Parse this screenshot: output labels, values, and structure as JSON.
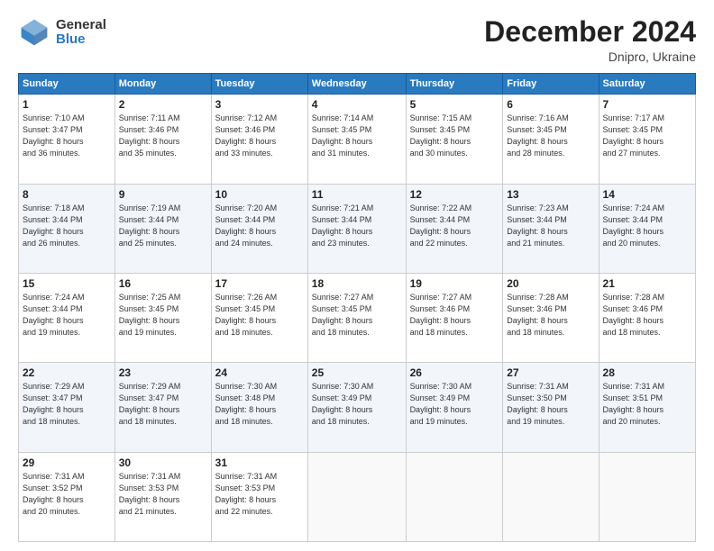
{
  "logo": {
    "general": "General",
    "blue": "Blue"
  },
  "title": {
    "month": "December 2024",
    "location": "Dnipro, Ukraine"
  },
  "weekdays": [
    "Sunday",
    "Monday",
    "Tuesday",
    "Wednesday",
    "Thursday",
    "Friday",
    "Saturday"
  ],
  "weeks": [
    [
      {
        "day": "1",
        "detail": "Sunrise: 7:10 AM\nSunset: 3:47 PM\nDaylight: 8 hours\nand 36 minutes."
      },
      {
        "day": "2",
        "detail": "Sunrise: 7:11 AM\nSunset: 3:46 PM\nDaylight: 8 hours\nand 35 minutes."
      },
      {
        "day": "3",
        "detail": "Sunrise: 7:12 AM\nSunset: 3:46 PM\nDaylight: 8 hours\nand 33 minutes."
      },
      {
        "day": "4",
        "detail": "Sunrise: 7:14 AM\nSunset: 3:45 PM\nDaylight: 8 hours\nand 31 minutes."
      },
      {
        "day": "5",
        "detail": "Sunrise: 7:15 AM\nSunset: 3:45 PM\nDaylight: 8 hours\nand 30 minutes."
      },
      {
        "day": "6",
        "detail": "Sunrise: 7:16 AM\nSunset: 3:45 PM\nDaylight: 8 hours\nand 28 minutes."
      },
      {
        "day": "7",
        "detail": "Sunrise: 7:17 AM\nSunset: 3:45 PM\nDaylight: 8 hours\nand 27 minutes."
      }
    ],
    [
      {
        "day": "8",
        "detail": "Sunrise: 7:18 AM\nSunset: 3:44 PM\nDaylight: 8 hours\nand 26 minutes."
      },
      {
        "day": "9",
        "detail": "Sunrise: 7:19 AM\nSunset: 3:44 PM\nDaylight: 8 hours\nand 25 minutes."
      },
      {
        "day": "10",
        "detail": "Sunrise: 7:20 AM\nSunset: 3:44 PM\nDaylight: 8 hours\nand 24 minutes."
      },
      {
        "day": "11",
        "detail": "Sunrise: 7:21 AM\nSunset: 3:44 PM\nDaylight: 8 hours\nand 23 minutes."
      },
      {
        "day": "12",
        "detail": "Sunrise: 7:22 AM\nSunset: 3:44 PM\nDaylight: 8 hours\nand 22 minutes."
      },
      {
        "day": "13",
        "detail": "Sunrise: 7:23 AM\nSunset: 3:44 PM\nDaylight: 8 hours\nand 21 minutes."
      },
      {
        "day": "14",
        "detail": "Sunrise: 7:24 AM\nSunset: 3:44 PM\nDaylight: 8 hours\nand 20 minutes."
      }
    ],
    [
      {
        "day": "15",
        "detail": "Sunrise: 7:24 AM\nSunset: 3:44 PM\nDaylight: 8 hours\nand 19 minutes."
      },
      {
        "day": "16",
        "detail": "Sunrise: 7:25 AM\nSunset: 3:45 PM\nDaylight: 8 hours\nand 19 minutes."
      },
      {
        "day": "17",
        "detail": "Sunrise: 7:26 AM\nSunset: 3:45 PM\nDaylight: 8 hours\nand 18 minutes."
      },
      {
        "day": "18",
        "detail": "Sunrise: 7:27 AM\nSunset: 3:45 PM\nDaylight: 8 hours\nand 18 minutes."
      },
      {
        "day": "19",
        "detail": "Sunrise: 7:27 AM\nSunset: 3:46 PM\nDaylight: 8 hours\nand 18 minutes."
      },
      {
        "day": "20",
        "detail": "Sunrise: 7:28 AM\nSunset: 3:46 PM\nDaylight: 8 hours\nand 18 minutes."
      },
      {
        "day": "21",
        "detail": "Sunrise: 7:28 AM\nSunset: 3:46 PM\nDaylight: 8 hours\nand 18 minutes."
      }
    ],
    [
      {
        "day": "22",
        "detail": "Sunrise: 7:29 AM\nSunset: 3:47 PM\nDaylight: 8 hours\nand 18 minutes."
      },
      {
        "day": "23",
        "detail": "Sunrise: 7:29 AM\nSunset: 3:47 PM\nDaylight: 8 hours\nand 18 minutes."
      },
      {
        "day": "24",
        "detail": "Sunrise: 7:30 AM\nSunset: 3:48 PM\nDaylight: 8 hours\nand 18 minutes."
      },
      {
        "day": "25",
        "detail": "Sunrise: 7:30 AM\nSunset: 3:49 PM\nDaylight: 8 hours\nand 18 minutes."
      },
      {
        "day": "26",
        "detail": "Sunrise: 7:30 AM\nSunset: 3:49 PM\nDaylight: 8 hours\nand 19 minutes."
      },
      {
        "day": "27",
        "detail": "Sunrise: 7:31 AM\nSunset: 3:50 PM\nDaylight: 8 hours\nand 19 minutes."
      },
      {
        "day": "28",
        "detail": "Sunrise: 7:31 AM\nSunset: 3:51 PM\nDaylight: 8 hours\nand 20 minutes."
      }
    ],
    [
      {
        "day": "29",
        "detail": "Sunrise: 7:31 AM\nSunset: 3:52 PM\nDaylight: 8 hours\nand 20 minutes."
      },
      {
        "day": "30",
        "detail": "Sunrise: 7:31 AM\nSunset: 3:53 PM\nDaylight: 8 hours\nand 21 minutes."
      },
      {
        "day": "31",
        "detail": "Sunrise: 7:31 AM\nSunset: 3:53 PM\nDaylight: 8 hours\nand 22 minutes."
      },
      {
        "day": "",
        "detail": ""
      },
      {
        "day": "",
        "detail": ""
      },
      {
        "day": "",
        "detail": ""
      },
      {
        "day": "",
        "detail": ""
      }
    ]
  ]
}
